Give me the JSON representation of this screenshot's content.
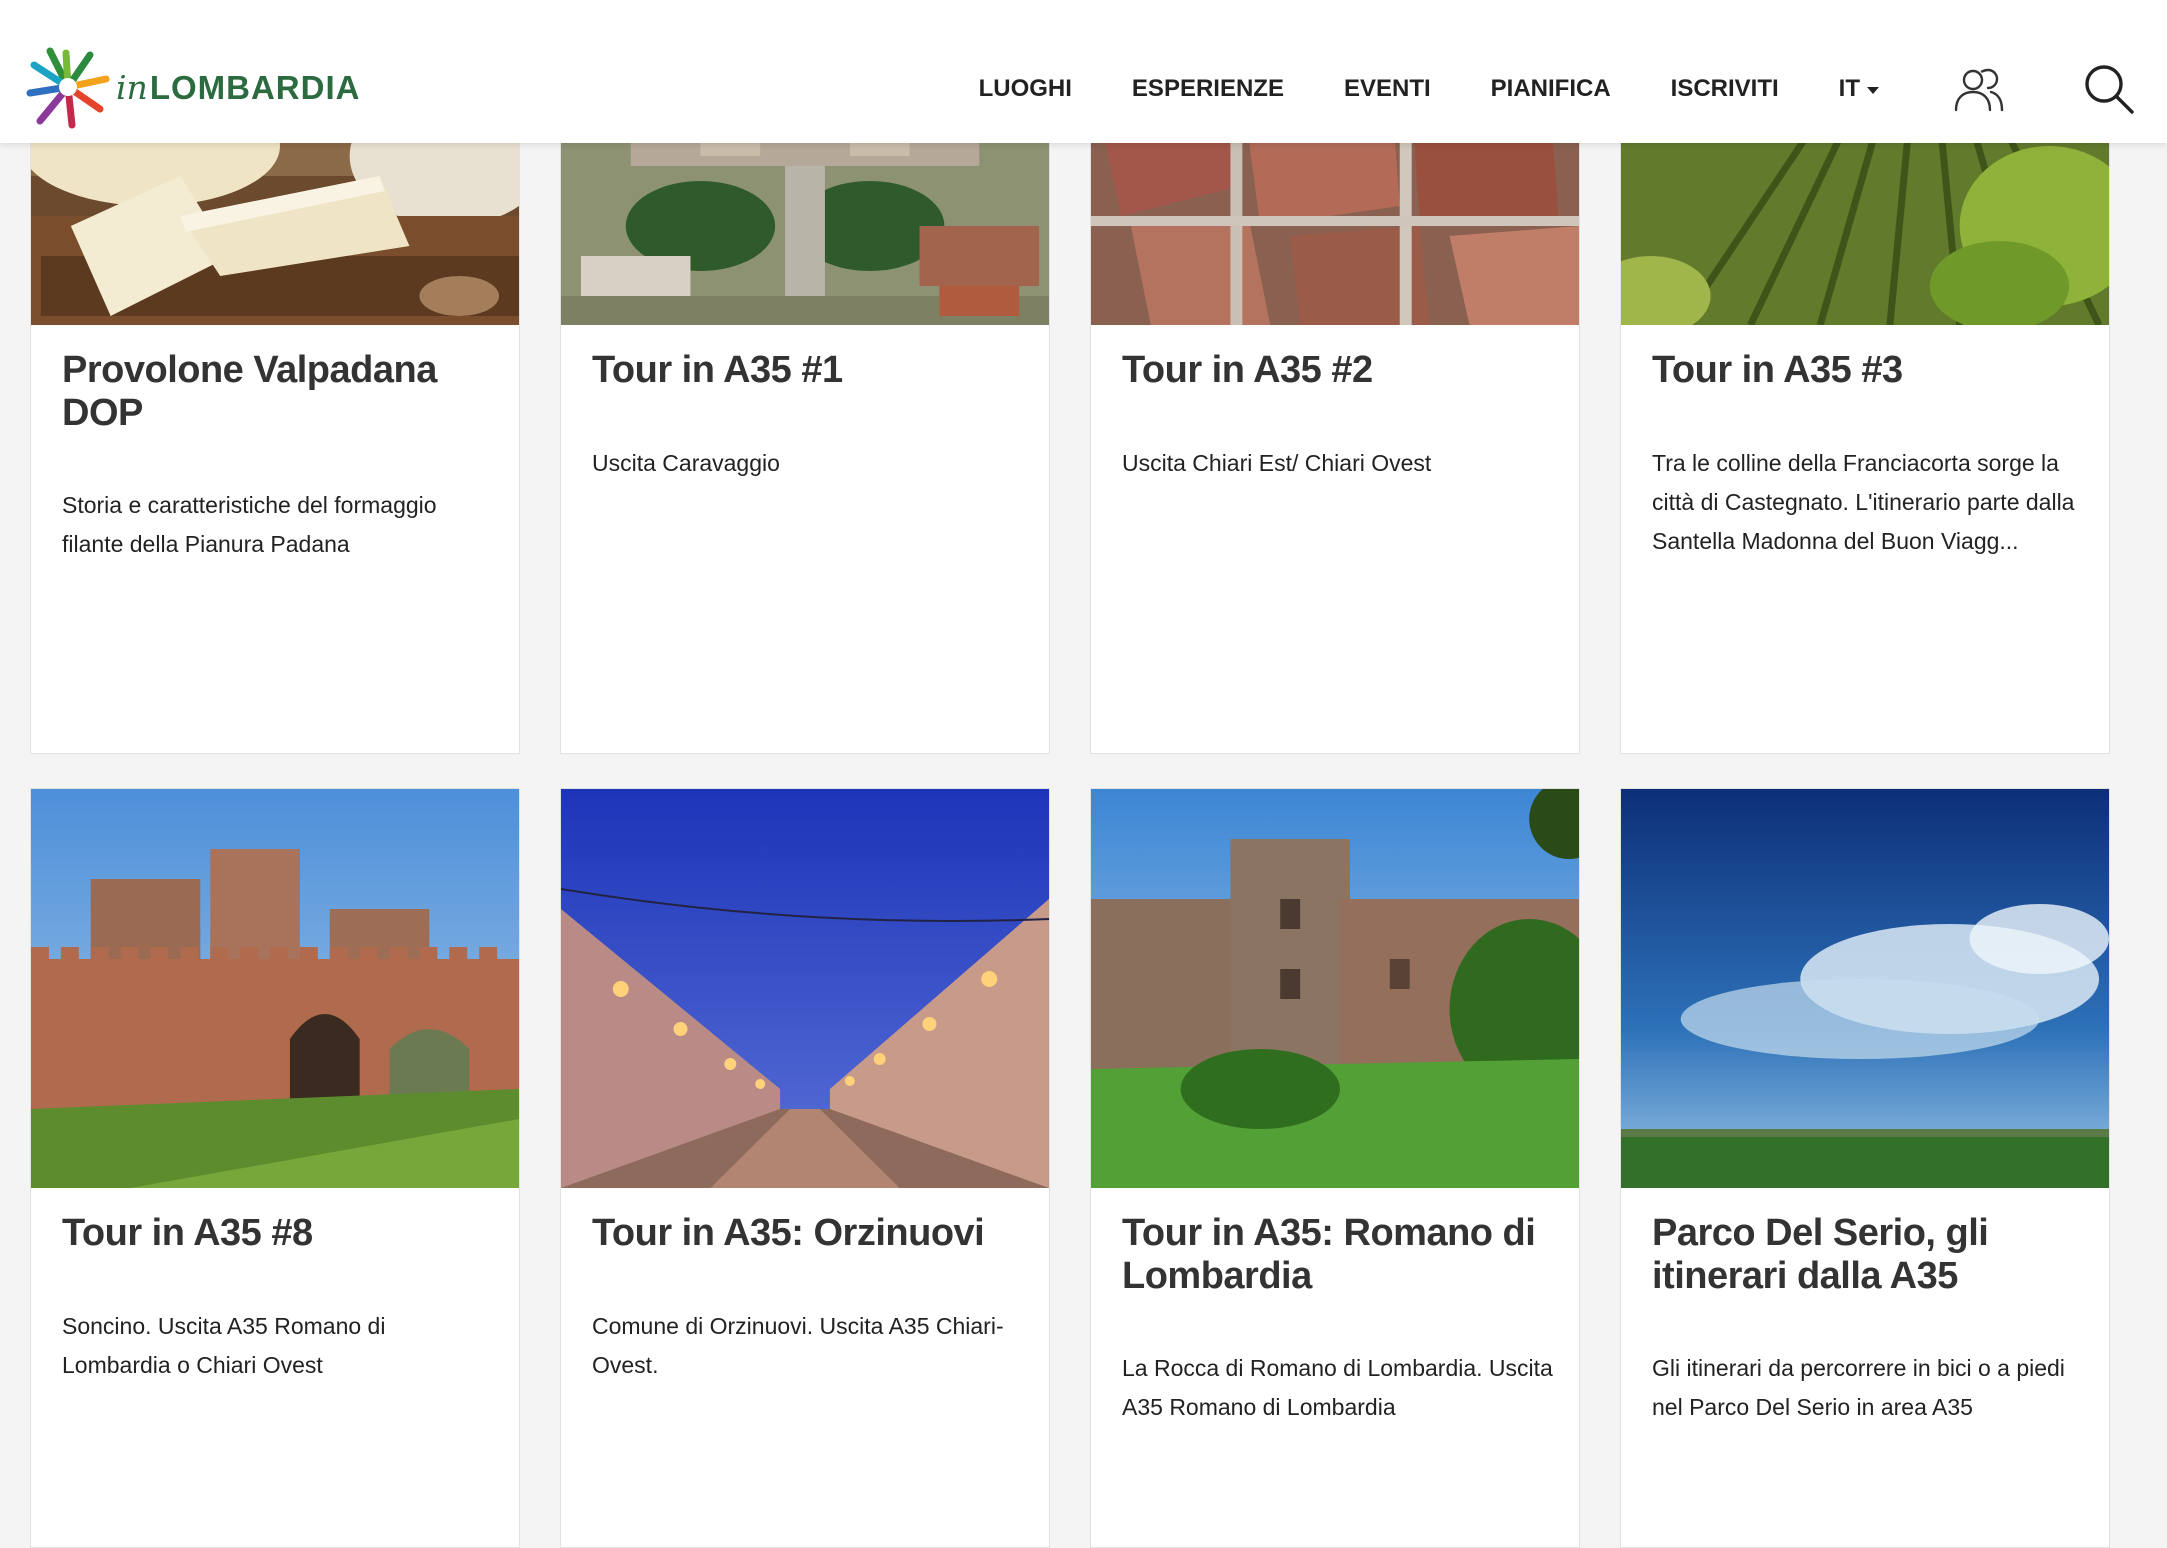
{
  "header": {
    "logo": {
      "prefix": "in",
      "name": "LOMBARDIA"
    },
    "nav": [
      "LUOGHI",
      "ESPERIENZE",
      "EVENTI",
      "PIANIFICA",
      "ISCRIVITI"
    ],
    "language": "IT",
    "icons": {
      "user": "user-group-icon",
      "search": "search-icon",
      "language_caret": "chevron-down-icon"
    }
  },
  "cards": [
    {
      "title": "Provolone Valpadana DOP",
      "description": "Storia e caratteristiche del formaggio filante della Pianura Padana",
      "image": "cheese-photo"
    },
    {
      "title": "Tour in A35 #1",
      "description": "Uscita Caravaggio",
      "image": "aerial-sanctuary-photo"
    },
    {
      "title": "Tour in A35 #2",
      "description": "Uscita Chiari Est/ Chiari Ovest",
      "image": "aerial-rooftops-photo"
    },
    {
      "title": "Tour in A35 #3",
      "description": "Tra le colline della Franciacorta sorge la città di Castegnato. L'itinerario parte dalla Santella Madonna del Buon Viagg...",
      "image": "vineyard-photo"
    },
    {
      "title": "Tour in A35 #8",
      "description": "Soncino. Uscita A35 Romano di Lombardia o Chiari Ovest",
      "image": "castle-photo"
    },
    {
      "title": "Tour in A35: Orzinuovi",
      "description": "Comune di Orzinuovi. Uscita A35 Chiari-Ovest.",
      "image": "street-dusk-photo"
    },
    {
      "title": "Tour in A35: Romano di Lombardia",
      "description": "La Rocca di Romano di Lombardia. Uscita A35 Romano di Lombardia",
      "image": "rocca-photo"
    },
    {
      "title": "Parco Del Serio, gli itinerari dalla A35",
      "description": "Gli itinerari da percorrere in bici o a piedi nel Parco Del Serio in area A35",
      "image": "sky-field-photo"
    }
  ],
  "colors": {
    "brand_green": "#2c6a3f",
    "page_background": "#f4f4f4",
    "card_background": "#ffffff",
    "text": "#333333"
  }
}
